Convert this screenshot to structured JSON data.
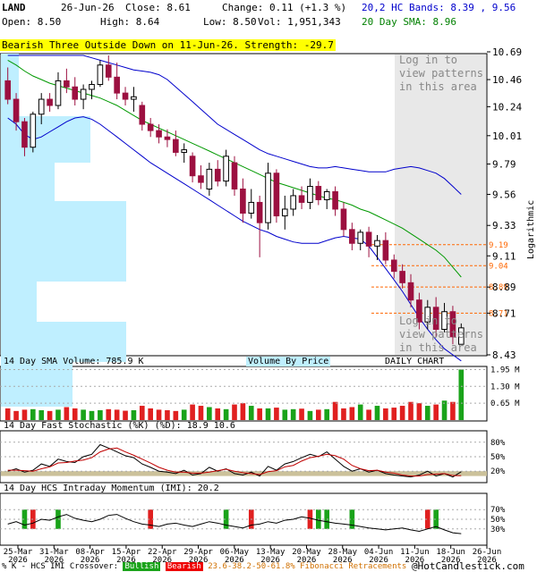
{
  "header": {
    "symbol": "LAND",
    "date": "26-Jun-26",
    "close": "Close: 8.61",
    "change": "Change: 0.11 (+1.3 %)",
    "open": "Open: 8.50",
    "high": "High: 8.64",
    "low": "Low: 8.50",
    "vol": "Vol: 1,951,343",
    "hc_bands": "20,2 HC Bands: 8.39 , 9.56",
    "sma20": "20 Day SMA: 8.96",
    "pattern_banner": "Bearish Three Outside Down on 11-Jun-26. Strength: -29.7",
    "login_upper": "Log in to view patterns in this area",
    "login_lower": "Log in to view patterns in this area"
  },
  "panel_labels": {
    "volume": "14 Day SMA Volume: 785.9 K",
    "volume_by_price": "Volume By Price",
    "daily_chart": "DAILY CHART",
    "stoch": "14 Day Fast Stochastic (%K) (%D): 18.9   10.6",
    "momentum": "14 Day HCS Intraday Momentum (IMI): 20.2",
    "logarithmic": "Logarithmic"
  },
  "footer": {
    "legend_prefix": "% K - HCS IMI Crossover:",
    "bullish": "Bullish",
    "bearish": "Bearish",
    "fib": "23.6-38.2-50-61.8% Fibonacci Retracements",
    "copyright": "@HotCandlestick.com"
  },
  "colors": {
    "up": "#1aa31a",
    "down": "#9c1040",
    "sma": "#009900",
    "bands": "#0000cc",
    "vbp": "#bfefff",
    "fib": "#ff6600",
    "highlight": "#ffff00",
    "shade": "#e8e8e8"
  },
  "chart_data": [
    {
      "type": "candlestick",
      "title": "LAND daily",
      "x_ticks": [
        "25-Mar 2026",
        "31-Mar 2026",
        "08-Apr 2026",
        "15-Apr 2026",
        "22-Apr 2026",
        "29-Apr 2026",
        "06-May 2026",
        "13-May 2026",
        "20-May 2026",
        "28-May 2026",
        "04-Jun 2026",
        "11-Jun 2026",
        "18-Jun 2026",
        "26-Jun 2026"
      ],
      "y_ticks": [
        10.69,
        10.46,
        10.24,
        10.01,
        9.79,
        9.56,
        9.33,
        9.11,
        8.89,
        8.71,
        8.43
      ],
      "fib_levels": [
        9.19,
        9.04,
        8.89,
        8.71
      ],
      "ylim": [
        8.43,
        10.69
      ],
      "scale": "log",
      "candles": [
        [
          10.45,
          10.56,
          10.26,
          10.3
        ],
        [
          10.3,
          10.35,
          10.05,
          10.12
        ],
        [
          10.12,
          10.15,
          9.85,
          9.92
        ],
        [
          9.92,
          10.2,
          9.88,
          10.18
        ],
        [
          10.18,
          10.35,
          10.1,
          10.3
        ],
        [
          10.3,
          10.35,
          10.2,
          10.25
        ],
        [
          10.25,
          10.52,
          10.22,
          10.45
        ],
        [
          10.45,
          10.55,
          10.35,
          10.4
        ],
        [
          10.4,
          10.48,
          10.25,
          10.3
        ],
        [
          10.3,
          10.42,
          10.22,
          10.38
        ],
        [
          10.38,
          10.45,
          10.3,
          10.42
        ],
        [
          10.42,
          10.62,
          10.4,
          10.58
        ],
        [
          10.58,
          10.66,
          10.45,
          10.48
        ],
        [
          10.48,
          10.6,
          10.3,
          10.35
        ],
        [
          10.35,
          10.4,
          10.25,
          10.3
        ],
        [
          10.3,
          10.4,
          10.2,
          10.32
        ],
        [
          10.25,
          10.28,
          10.05,
          10.1
        ],
        [
          10.1,
          10.15,
          10.0,
          10.05
        ],
        [
          10.05,
          10.1,
          9.95,
          10.0
        ],
        [
          10.0,
          10.06,
          9.92,
          9.98
        ],
        [
          9.98,
          10.05,
          9.85,
          9.88
        ],
        [
          9.88,
          9.95,
          9.8,
          9.9
        ],
        [
          9.85,
          9.88,
          9.65,
          9.7
        ],
        [
          9.7,
          9.78,
          9.6,
          9.65
        ],
        [
          9.6,
          9.8,
          9.55,
          9.75
        ],
        [
          9.75,
          9.82,
          9.62,
          9.66
        ],
        [
          9.66,
          9.9,
          9.62,
          9.85
        ],
        [
          9.8,
          9.85,
          9.55,
          9.6
        ],
        [
          9.6,
          9.68,
          9.35,
          9.42
        ],
        [
          9.42,
          9.6,
          9.38,
          9.5
        ],
        [
          9.5,
          9.55,
          9.1,
          9.35
        ],
        [
          9.35,
          9.8,
          9.3,
          9.72
        ],
        [
          9.72,
          9.75,
          9.35,
          9.4
        ],
        [
          9.4,
          9.55,
          9.3,
          9.45
        ],
        [
          9.45,
          9.6,
          9.4,
          9.55
        ],
        [
          9.55,
          9.62,
          9.45,
          9.5
        ],
        [
          9.5,
          9.68,
          9.45,
          9.62
        ],
        [
          9.62,
          9.66,
          9.48,
          9.52
        ],
        [
          9.52,
          9.6,
          9.45,
          9.58
        ],
        [
          9.58,
          9.62,
          9.4,
          9.45
        ],
        [
          9.45,
          9.5,
          9.25,
          9.3
        ],
        [
          9.3,
          9.35,
          9.15,
          9.2
        ],
        [
          9.2,
          9.3,
          9.15,
          9.28
        ],
        [
          9.28,
          9.32,
          9.1,
          9.18
        ],
        [
          9.18,
          9.26,
          9.08,
          9.22
        ],
        [
          9.22,
          9.28,
          9.05,
          9.08
        ],
        [
          9.08,
          9.12,
          8.95,
          9.0
        ],
        [
          9.0,
          9.05,
          8.88,
          8.92
        ],
        [
          8.92,
          8.98,
          8.75,
          8.8
        ],
        [
          8.8,
          8.85,
          8.6,
          8.65
        ],
        [
          8.65,
          8.8,
          8.6,
          8.75
        ],
        [
          8.75,
          8.82,
          8.55,
          8.6
        ],
        [
          8.6,
          8.78,
          8.58,
          8.72
        ],
        [
          8.72,
          8.76,
          8.5,
          8.55
        ],
        [
          8.5,
          8.64,
          8.5,
          8.61
        ]
      ],
      "sma20": [
        10.62,
        10.58,
        10.53,
        10.49,
        10.46,
        10.43,
        10.41,
        10.39,
        10.37,
        10.35,
        10.33,
        10.31,
        10.28,
        10.25,
        10.21,
        10.17,
        10.13,
        10.1,
        10.07,
        10.04,
        10.01,
        9.98,
        9.95,
        9.92,
        9.89,
        9.86,
        9.83,
        9.8,
        9.77,
        9.74,
        9.71,
        9.68,
        9.65,
        9.63,
        9.61,
        9.59,
        9.57,
        9.55,
        9.53,
        9.52,
        9.5,
        9.48,
        9.45,
        9.43,
        9.4,
        9.37,
        9.34,
        9.31,
        9.27,
        9.23,
        9.19,
        9.15,
        9.1,
        9.03,
        8.96
      ],
      "upper_band": [
        10.66,
        10.66,
        10.66,
        10.66,
        10.66,
        10.66,
        10.66,
        10.66,
        10.66,
        10.66,
        10.64,
        10.62,
        10.6,
        10.58,
        10.56,
        10.54,
        10.53,
        10.52,
        10.5,
        10.46,
        10.4,
        10.34,
        10.28,
        10.22,
        10.16,
        10.1,
        10.06,
        10.02,
        9.98,
        9.94,
        9.9,
        9.87,
        9.85,
        9.83,
        9.81,
        9.79,
        9.77,
        9.76,
        9.76,
        9.77,
        9.76,
        9.75,
        9.74,
        9.73,
        9.73,
        9.73,
        9.75,
        9.76,
        9.77,
        9.76,
        9.74,
        9.72,
        9.68,
        9.62,
        9.56
      ],
      "lower_band": [
        10.15,
        10.1,
        10.02,
        9.98,
        10.0,
        10.04,
        10.08,
        10.12,
        10.15,
        10.16,
        10.14,
        10.1,
        10.05,
        10.0,
        9.95,
        9.9,
        9.85,
        9.8,
        9.76,
        9.72,
        9.68,
        9.64,
        9.6,
        9.56,
        9.52,
        9.48,
        9.44,
        9.4,
        9.36,
        9.33,
        9.3,
        9.28,
        9.25,
        9.23,
        9.21,
        9.2,
        9.2,
        9.2,
        9.22,
        9.24,
        9.25,
        9.24,
        9.23,
        9.18,
        9.1,
        9.02,
        8.94,
        8.86,
        8.77,
        8.68,
        8.6,
        8.53,
        8.47,
        8.43,
        8.39
      ]
    },
    {
      "type": "bar",
      "title": "14 Day SMA Volume",
      "y_ticks": [
        "1.95 M",
        "1.30 M",
        "0.65 M"
      ],
      "ylim": [
        0,
        2.0
      ],
      "values": [
        0.45,
        0.35,
        0.4,
        0.42,
        0.38,
        0.35,
        0.4,
        0.5,
        0.45,
        0.4,
        0.35,
        0.38,
        0.42,
        0.4,
        0.36,
        0.38,
        0.55,
        0.45,
        0.4,
        0.38,
        0.35,
        0.4,
        0.6,
        0.55,
        0.5,
        0.45,
        0.42,
        0.6,
        0.65,
        0.55,
        0.45,
        0.45,
        0.48,
        0.4,
        0.42,
        0.44,
        0.35,
        0.4,
        0.42,
        0.7,
        0.45,
        0.5,
        0.6,
        0.4,
        0.55,
        0.45,
        0.48,
        0.55,
        0.7,
        0.65,
        0.55,
        0.6,
        0.75,
        0.7,
        1.95
      ]
    },
    {
      "type": "line",
      "title": "14 Day Fast Stochastic",
      "y_ticks": [
        "80%",
        "50%",
        "20%"
      ],
      "ylim": [
        0,
        100
      ],
      "k": [
        20,
        25,
        18,
        22,
        35,
        30,
        45,
        40,
        38,
        50,
        55,
        75,
        68,
        60,
        52,
        48,
        35,
        28,
        20,
        18,
        15,
        22,
        12,
        15,
        28,
        20,
        25,
        15,
        12,
        18,
        10,
        30,
        22,
        35,
        40,
        48,
        55,
        50,
        60,
        45,
        30,
        20,
        25,
        18,
        22,
        15,
        12,
        10,
        8,
        12,
        20,
        10,
        15,
        8,
        18.9
      ],
      "d": [
        22,
        22,
        21,
        20,
        25,
        29,
        37,
        38,
        41,
        43,
        48,
        60,
        66,
        68,
        60,
        53,
        45,
        37,
        28,
        22,
        18,
        18,
        16,
        16,
        18,
        21,
        24,
        20,
        17,
        15,
        13,
        19,
        21,
        29,
        32,
        41,
        48,
        51,
        55,
        52,
        45,
        32,
        25,
        21,
        22,
        18,
        16,
        12,
        10,
        10,
        13,
        14,
        15,
        11,
        10.6
      ]
    },
    {
      "type": "line",
      "title": "14 Day HCS Intraday Momentum",
      "y_ticks": [
        "70%",
        "50%",
        "30%"
      ],
      "ylim": [
        0,
        100
      ],
      "imi": [
        40,
        45,
        38,
        42,
        50,
        48,
        55,
        60,
        52,
        48,
        45,
        50,
        58,
        60,
        52,
        45,
        40,
        38,
        35,
        40,
        42,
        38,
        35,
        40,
        45,
        42,
        38,
        35,
        32,
        38,
        40,
        45,
        42,
        48,
        50,
        55,
        52,
        48,
        45,
        42,
        40,
        38,
        35,
        32,
        30,
        28,
        30,
        32,
        28,
        25,
        30,
        35,
        28,
        22,
        20.2
      ],
      "bullish_crossovers": [
        2,
        6,
        26,
        37,
        38,
        41,
        51
      ],
      "bearish_crossovers": [
        3,
        17,
        29,
        36,
        50
      ]
    }
  ]
}
